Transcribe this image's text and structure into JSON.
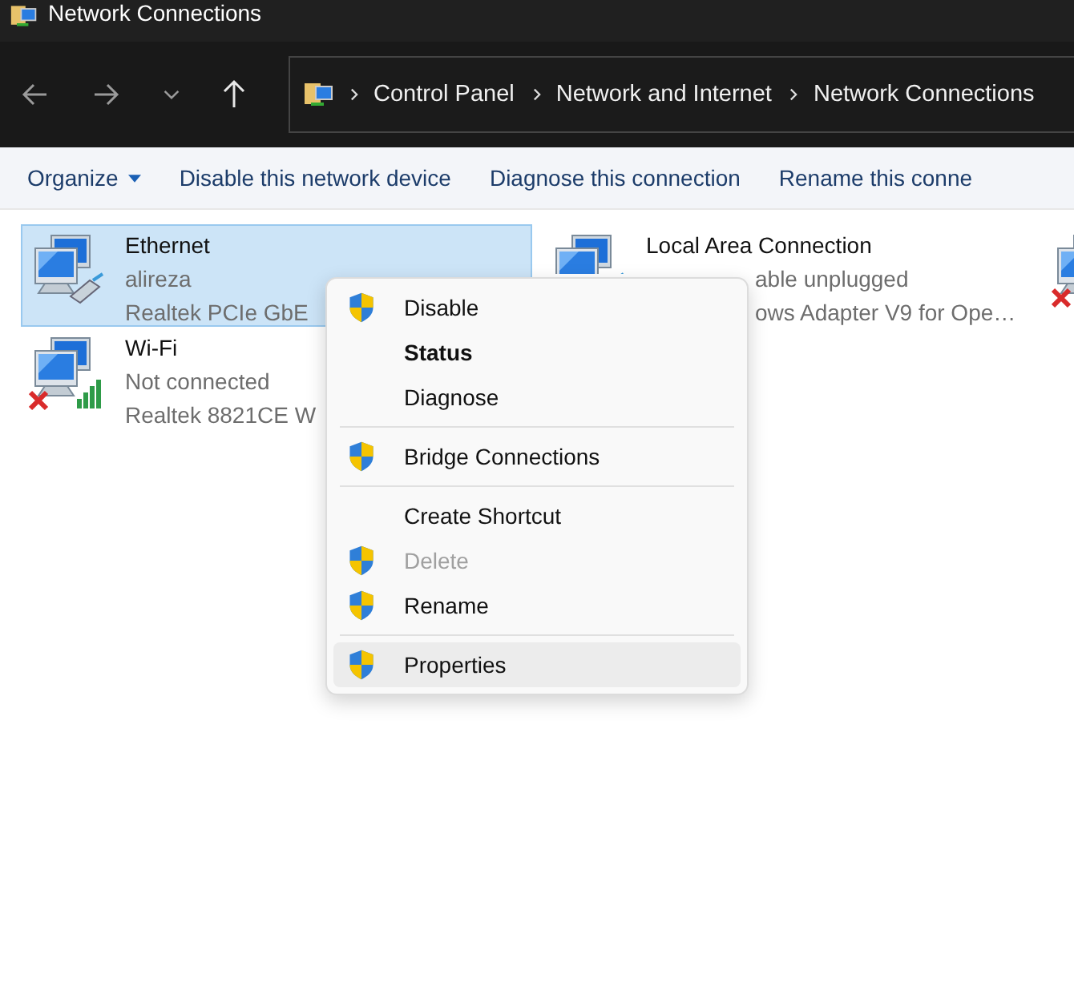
{
  "window": {
    "title": "Network Connections"
  },
  "address_bar": {
    "breadcrumbs": [
      "Control Panel",
      "Network and Internet",
      "Network Connections"
    ]
  },
  "command_bar": [
    {
      "label": "Organize",
      "dropdown": true
    },
    {
      "label": "Disable this network device",
      "dropdown": false
    },
    {
      "label": "Diagnose this connection",
      "dropdown": false
    },
    {
      "label": "Rename this conne",
      "dropdown": false
    }
  ],
  "connections": [
    {
      "kind": "ethernet",
      "name": "Ethernet",
      "status": "alireza",
      "adapter": "Realtek PCIe GbE",
      "selected": true,
      "disconnected": false
    },
    {
      "kind": "ethernet",
      "name": "Local Area Connection",
      "status": "able unplugged",
      "adapter": "ows Adapter V9 for Ope…",
      "selected": false,
      "disconnected": false
    },
    {
      "kind": "ethernet",
      "disconnected": true
    },
    {
      "kind": "wifi",
      "name": "Wi-Fi",
      "status": "Not connected",
      "adapter": "Realtek 8821CE W",
      "selected": false,
      "disconnected": true
    }
  ],
  "context_menu": [
    {
      "label": "Disable",
      "shield": true,
      "bold": false,
      "disabled": false,
      "selected": false,
      "separator_after": false
    },
    {
      "label": "Status",
      "shield": false,
      "bold": true,
      "disabled": false,
      "selected": false,
      "separator_after": false
    },
    {
      "label": "Diagnose",
      "shield": false,
      "bold": false,
      "disabled": false,
      "selected": false,
      "separator_after": true
    },
    {
      "label": "Bridge Connections",
      "shield": true,
      "bold": false,
      "disabled": false,
      "selected": false,
      "separator_after": true
    },
    {
      "label": "Create Shortcut",
      "shield": false,
      "bold": false,
      "disabled": false,
      "selected": false,
      "separator_after": false
    },
    {
      "label": "Delete",
      "shield": true,
      "bold": false,
      "disabled": true,
      "selected": false,
      "separator_after": false
    },
    {
      "label": "Rename",
      "shield": true,
      "bold": false,
      "disabled": false,
      "selected": false,
      "separator_after": true
    },
    {
      "label": "Properties",
      "shield": true,
      "bold": false,
      "disabled": false,
      "selected": true,
      "separator_after": false
    }
  ]
}
